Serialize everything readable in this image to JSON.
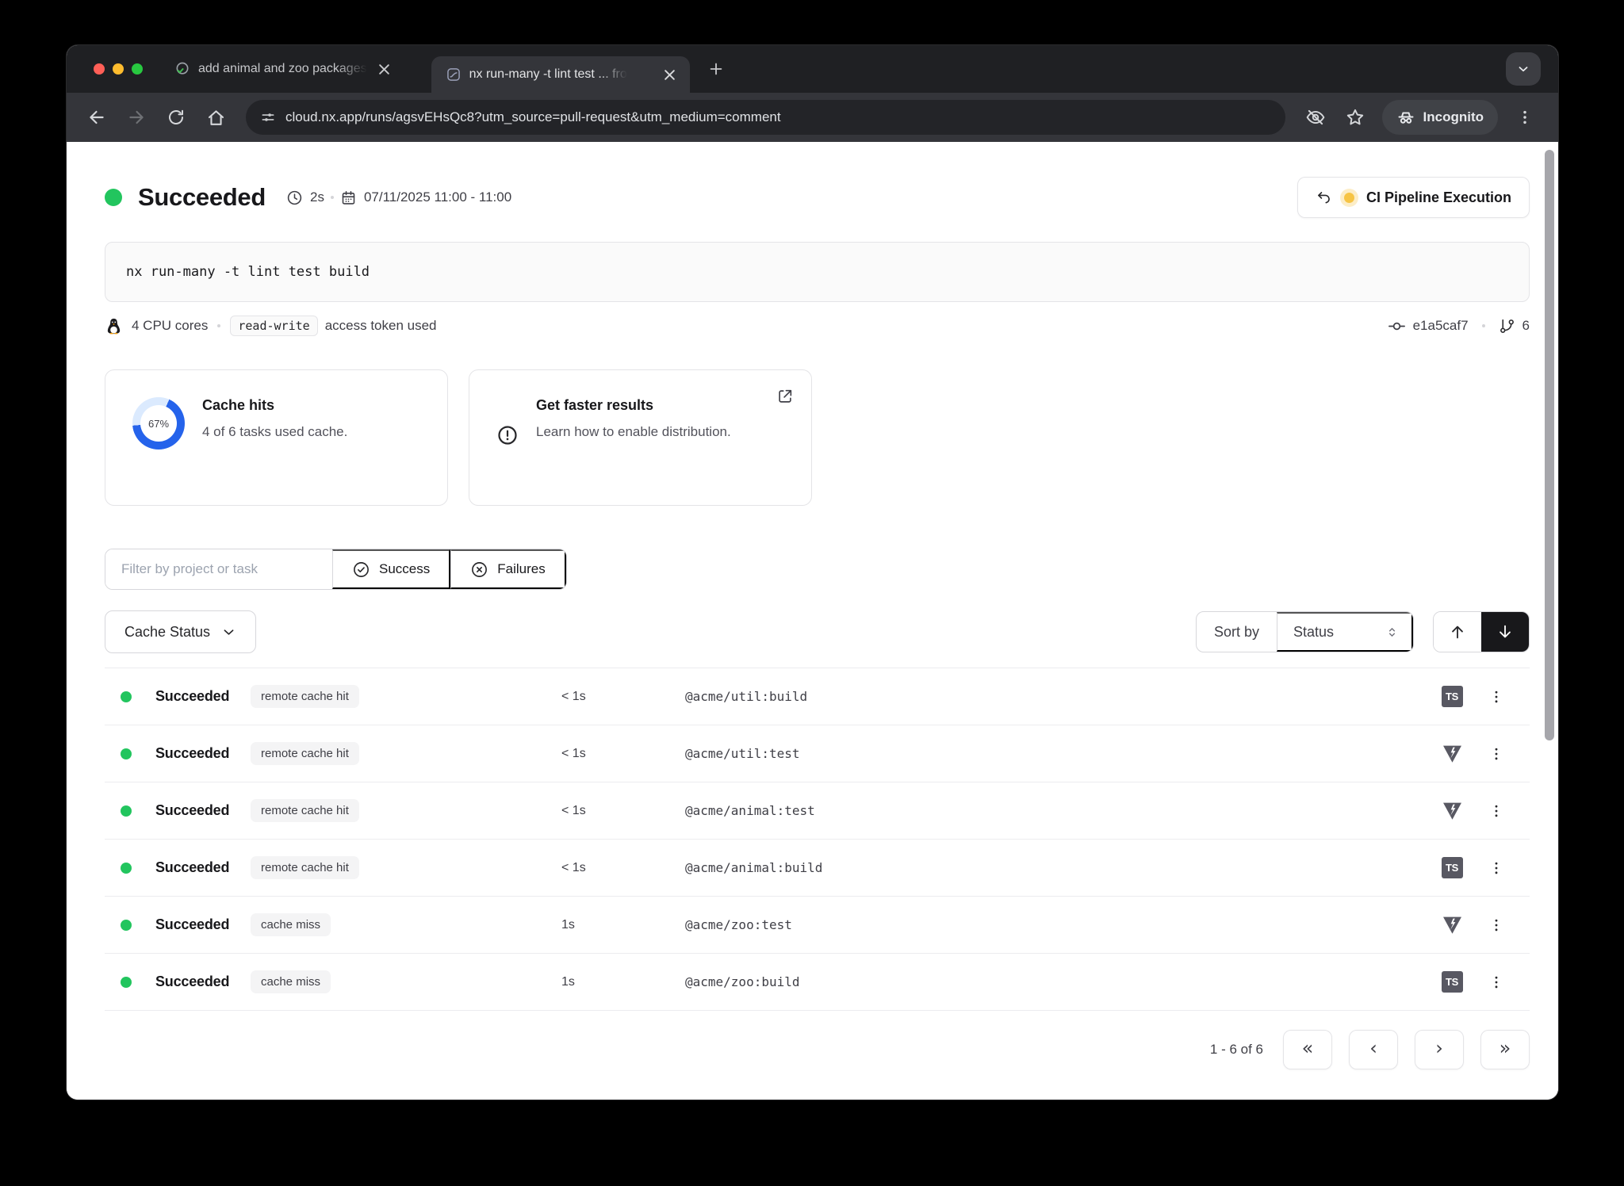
{
  "browser": {
    "tab1": {
      "title": "add animal and zoo packages"
    },
    "tab2": {
      "title": "nx run-many -t lint test ... fro"
    },
    "url": "cloud.nx.app/runs/agsvEHsQc8?utm_source=pull-request&utm_medium=comment",
    "incognito_label": "Incognito"
  },
  "header": {
    "status": "Succeeded",
    "duration": "2s",
    "date_range": "07/11/2025 11:00 - 11:00",
    "pipeline_button": "CI Pipeline Execution"
  },
  "run": {
    "command": "nx run-many -t lint test build",
    "cpu": "4 CPU cores",
    "token": "read-write",
    "token_suffix": "access token used",
    "commit": "e1a5caf7",
    "vcs_count": "6"
  },
  "cards": {
    "cache_percent": "67%",
    "cache_title": "Cache hits",
    "cache_subtitle": "4 of 6 tasks used cache.",
    "dist_title": "Get faster results",
    "dist_subtitle": "Learn how to enable distribution."
  },
  "filters": {
    "placeholder": "Filter by project or task",
    "success": "Success",
    "failures": "Failures",
    "cache_status": "Cache Status",
    "sort_by": "Sort by",
    "sort_value": "Status"
  },
  "table": {
    "rows": [
      {
        "status": "Succeeded",
        "badge": "remote cache hit",
        "time": "< 1s",
        "task": "@acme/util:build",
        "tool": "typescript"
      },
      {
        "status": "Succeeded",
        "badge": "remote cache hit",
        "time": "< 1s",
        "task": "@acme/util:test",
        "tool": "vitest"
      },
      {
        "status": "Succeeded",
        "badge": "remote cache hit",
        "time": "< 1s",
        "task": "@acme/animal:test",
        "tool": "vitest"
      },
      {
        "status": "Succeeded",
        "badge": "remote cache hit",
        "time": "< 1s",
        "task": "@acme/animal:build",
        "tool": "typescript"
      },
      {
        "status": "Succeeded",
        "badge": "cache miss",
        "time": "1s",
        "task": "@acme/zoo:test",
        "tool": "vitest"
      },
      {
        "status": "Succeeded",
        "badge": "cache miss",
        "time": "1s",
        "task": "@acme/zoo:build",
        "tool": "typescript"
      }
    ]
  },
  "tools": {
    "ts_label": "TS"
  },
  "pagination": {
    "range": "1 - 6 of 6",
    "first": "«",
    "prev": "‹",
    "next": "›",
    "last": "»"
  },
  "colors": {
    "success_green": "#22c55e",
    "accent_blue": "#2563eb",
    "amber": "#f6c445"
  }
}
